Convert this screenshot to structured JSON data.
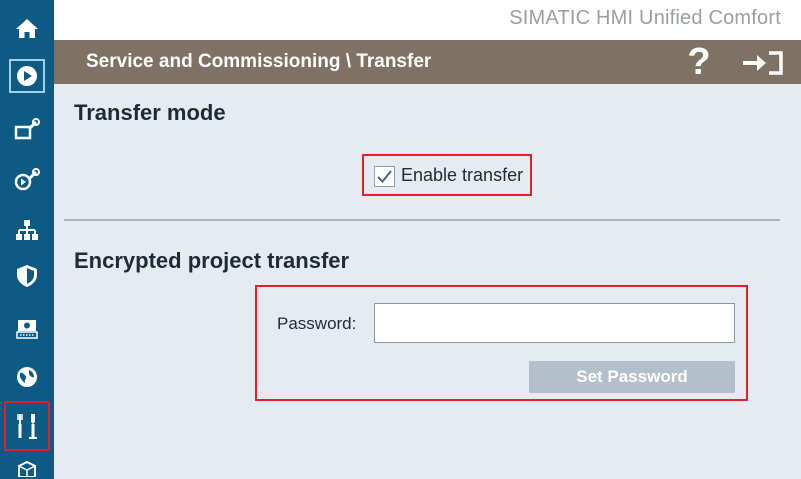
{
  "brand": {
    "title": "SIMATIC HMI Unified Comfort"
  },
  "header": {
    "title": "Service and Commissioning \\ Transfer",
    "help_label": "?"
  },
  "sidebar": {
    "items": [
      {
        "icon": "home-icon"
      },
      {
        "icon": "play-icon"
      },
      {
        "icon": "panel-settings-icon"
      },
      {
        "icon": "runtime-settings-icon"
      },
      {
        "icon": "network-icon"
      },
      {
        "icon": "security-shield-icon"
      },
      {
        "icon": "screen-keyboard-icon"
      },
      {
        "icon": "globe-icon"
      },
      {
        "icon": "service-tools-icon",
        "active": true
      },
      {
        "icon": "package-icon"
      }
    ]
  },
  "transfer_mode": {
    "title": "Transfer mode",
    "enable_label": "Enable transfer",
    "enabled": true
  },
  "encrypted": {
    "title": "Encrypted project transfer",
    "password_label": "Password:",
    "password_value": "",
    "set_button": "Set Password"
  },
  "colors": {
    "sidebar": "#0d5a85",
    "header": "#7f7265",
    "content": "#e6ebf1",
    "highlight": "#e0202a",
    "button_disabled": "#b3bfcb"
  }
}
